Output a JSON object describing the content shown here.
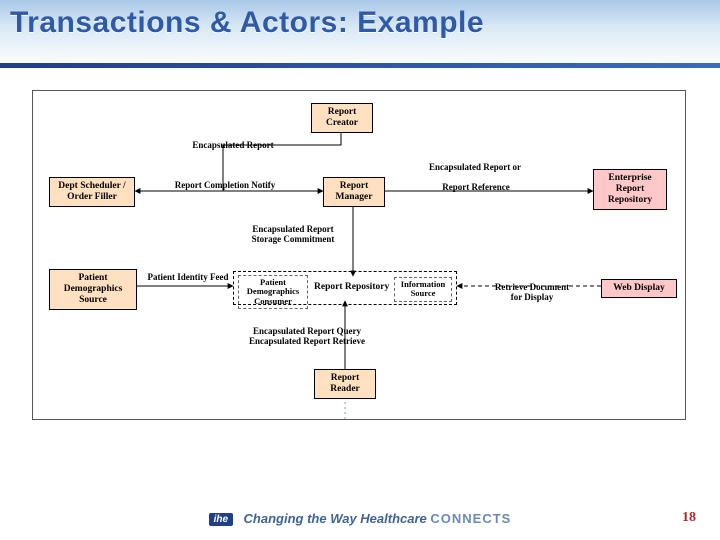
{
  "slide": {
    "title": "Transactions & Actors: Example",
    "page_number": "18",
    "footer_brand": "ihe",
    "footer_tagline_a": "Changing the Way Healthcare",
    "footer_tagline_b": "CONNECTS"
  },
  "actors": {
    "report_creator": "Report\nCreator",
    "dept_scheduler": "Dept Scheduler /\nOrder Filler",
    "report_manager": "Report\nManager",
    "enterprise_repo": "Enterprise\nReport\nRepository",
    "patient_demo_source": "Patient\nDemographics\nSource",
    "report_repository_group_label": "Report Repository",
    "patient_demo_consumer": "Patient\nDemographics\nConsumer",
    "information_source": "Information\nSource",
    "web_display": "Web Display",
    "report_reader": "Report\nReader"
  },
  "transactions": {
    "encapsulated_report": "Encapsulated Report",
    "report_completion_notify": "Report Completion Notify",
    "encapsulated_report_or": "Encapsulated Report or",
    "report_reference": "Report Reference",
    "encaps_storage_commit": "Encapsulated Report\nStorage Commitment",
    "patient_identity_feed": "Patient Identity Feed",
    "retrieve_doc_display": "Retrieve Document\nfor Display",
    "encaps_query_retrieve": "Encapsulated Report Query\nEncapsulated Report Retrieve"
  },
  "chart_data": {
    "type": "diagram",
    "nodes": [
      {
        "id": "report_creator",
        "label": "Report Creator",
        "kind": "actor"
      },
      {
        "id": "dept_scheduler",
        "label": "Dept Scheduler / Order Filler",
        "kind": "actor"
      },
      {
        "id": "report_manager",
        "label": "Report Manager",
        "kind": "actor"
      },
      {
        "id": "enterprise_repo",
        "label": "Enterprise Report Repository",
        "kind": "actor"
      },
      {
        "id": "patient_demo_source",
        "label": "Patient Demographics Source",
        "kind": "actor"
      },
      {
        "id": "report_repository",
        "label": "Report Repository",
        "kind": "grouped-actor",
        "contains": [
          "patient_demo_consumer",
          "information_source"
        ]
      },
      {
        "id": "patient_demo_consumer",
        "label": "Patient Demographics Consumer",
        "kind": "grouped-sub"
      },
      {
        "id": "information_source",
        "label": "Information Source",
        "kind": "grouped-sub"
      },
      {
        "id": "web_display",
        "label": "Web Display",
        "kind": "actor"
      },
      {
        "id": "report_reader",
        "label": "Report Reader",
        "kind": "actor"
      }
    ],
    "edges": [
      {
        "from": "report_creator",
        "to": "report_manager",
        "label": "Encapsulated Report",
        "style": "solid"
      },
      {
        "from": "report_creator",
        "to": "dept_scheduler",
        "label": "Report Completion Notify",
        "style": "solid"
      },
      {
        "from": "report_manager",
        "to": "enterprise_repo",
        "label": "Encapsulated Report or Report Reference",
        "style": "solid"
      },
      {
        "from": "report_manager",
        "to": "report_repository",
        "label": "Encapsulated Report Storage Commitment",
        "style": "solid"
      },
      {
        "from": "patient_demo_source",
        "to": "report_repository",
        "label": "Patient Identity Feed",
        "style": "solid"
      },
      {
        "from": "web_display",
        "to": "report_repository",
        "label": "Retrieve Document for Display",
        "style": "dashed"
      },
      {
        "from": "report_reader",
        "to": "report_repository",
        "label": "Encapsulated Report Query / Encapsulated Report Retrieve",
        "style": "solid"
      }
    ]
  }
}
